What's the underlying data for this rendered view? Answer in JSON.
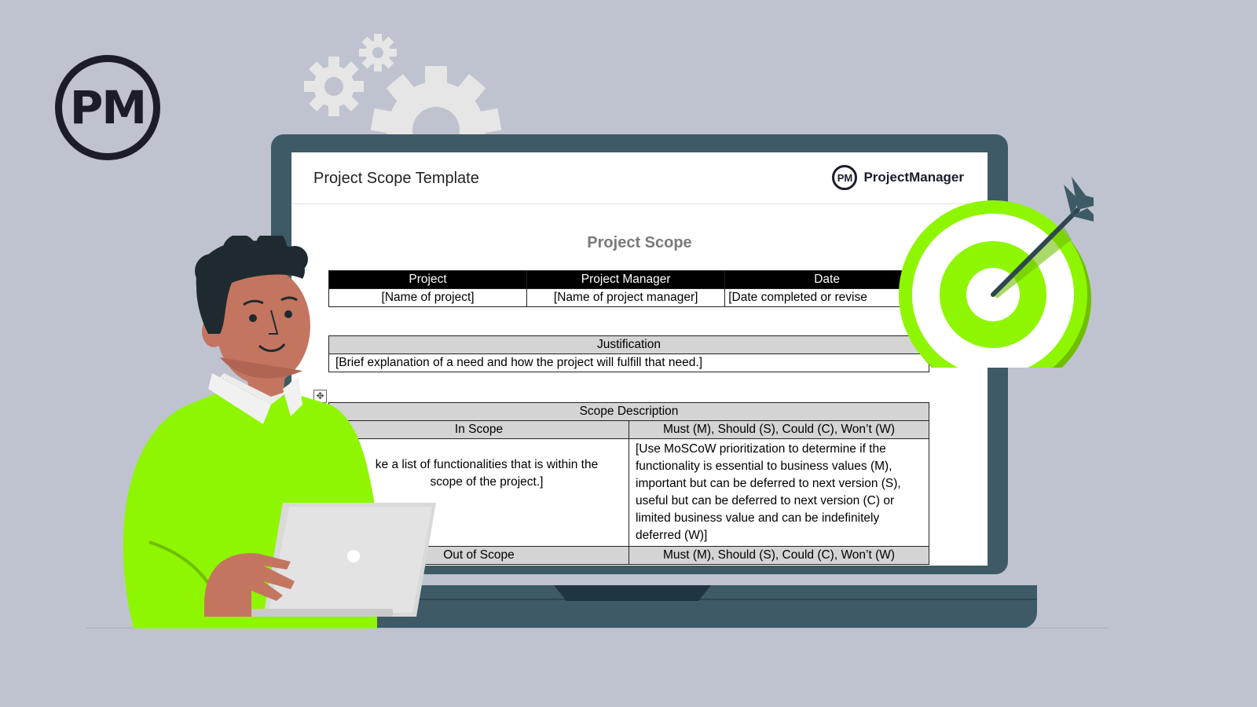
{
  "logo": {
    "text": "PM"
  },
  "document": {
    "window_title": "Project Scope Template",
    "brand_mark": "PM",
    "brand_name": "ProjectManager",
    "heading": "Project Scope",
    "info_table": {
      "headers": [
        "Project",
        "Project Manager",
        "Date"
      ],
      "values": [
        "[Name of project]",
        "[Name of project manager]",
        "[Date completed or revise"
      ]
    },
    "justification": {
      "header": "Justification",
      "value": "[Brief explanation of a need and how the project will fulfill that need.]"
    },
    "scope": {
      "header": "Scope Description",
      "in_scope_header": "In Scope",
      "moscow_header": "Must (M), Should (S), Could (C), Won’t (W)",
      "in_scope_value": "ke a list of functionalities that is within the scope of the project.]",
      "moscow_value": "[Use MoSCoW prioritization to determine if the functionality is essential to business values (M), important but can be deferred to next version (S), useful but can be deferred to next version (C) or limited business value and can be indefinitely deferred (W)]",
      "out_scope_header": "Out of Scope",
      "moscow_header_2": "Must (M), Should (S), Could (C), Won’t (W)"
    }
  },
  "colors": {
    "background": "#bfc3cf",
    "laptop": "#3d5a66",
    "accent_green": "#8ef600",
    "dark": "#1b1d2a"
  }
}
